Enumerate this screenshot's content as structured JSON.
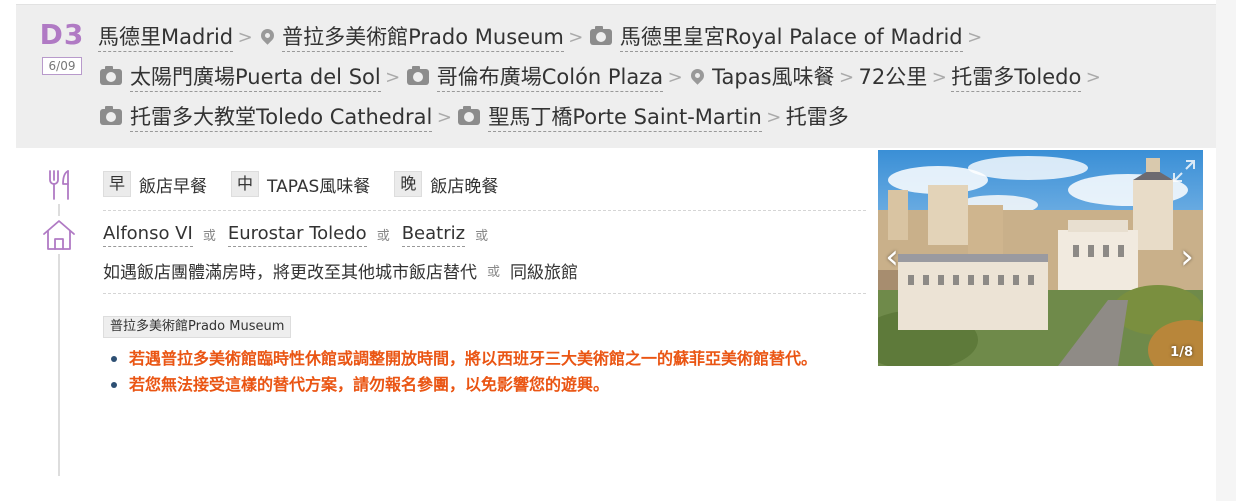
{
  "day": {
    "label": "D3",
    "date": "6/09"
  },
  "route": {
    "line1": [
      {
        "icon": "",
        "name": "馬德里Madrid"
      },
      {
        "icon": "map-pin-icon",
        "name": "普拉多美術館Prado Museum"
      },
      {
        "icon": "camera-icon",
        "name": "馬德里皇宮Royal Palace of Madrid"
      }
    ],
    "line2": [
      {
        "icon": "camera-icon",
        "name": "太陽門廣場Puerta del Sol"
      },
      {
        "icon": "camera-icon",
        "name": "哥倫布廣場Colón Plaza"
      },
      {
        "icon": "map-pin-icon",
        "name": "Tapas風味餐"
      },
      {
        "icon": "",
        "name": "72公里"
      },
      {
        "icon": "",
        "name": "托雷多Toledo"
      }
    ],
    "line3": [
      {
        "icon": "camera-icon",
        "name": "托雷多大教堂Toledo Cathedral"
      },
      {
        "icon": "camera-icon",
        "name": "聖馬丁橋Porte Saint-Martin"
      },
      {
        "icon": "",
        "name": "托雷多"
      }
    ],
    "separator": ">"
  },
  "meals": {
    "breakfast_tag": "早",
    "breakfast": "飯店早餐",
    "lunch_tag": "中",
    "lunch": "TAPAS風味餐",
    "dinner_tag": "晚",
    "dinner": "飯店晚餐"
  },
  "hotels": {
    "options": [
      "Alfonso VI",
      "Eurostar Toledo",
      "Beatriz"
    ],
    "or_word": "或",
    "note": "如遇飯店團體滿房時，將更改至其他城市飯店替代",
    "note_alt": "同級旅館"
  },
  "poi_tag": "普拉多美術館Prado Museum",
  "notes": [
    "若遇普拉多美術館臨時性休館或調整開放時間，將以西班牙三大美術館之一的蘇菲亞美術館替代。",
    "若您無法接受這樣的替代方案，請勿報名參團，以免影響您的遊興。"
  ],
  "photo": {
    "counter": "1/8"
  },
  "colors": {
    "accent": "#b07ac4",
    "note": "#ea5513",
    "icon": "#b07ac4"
  }
}
